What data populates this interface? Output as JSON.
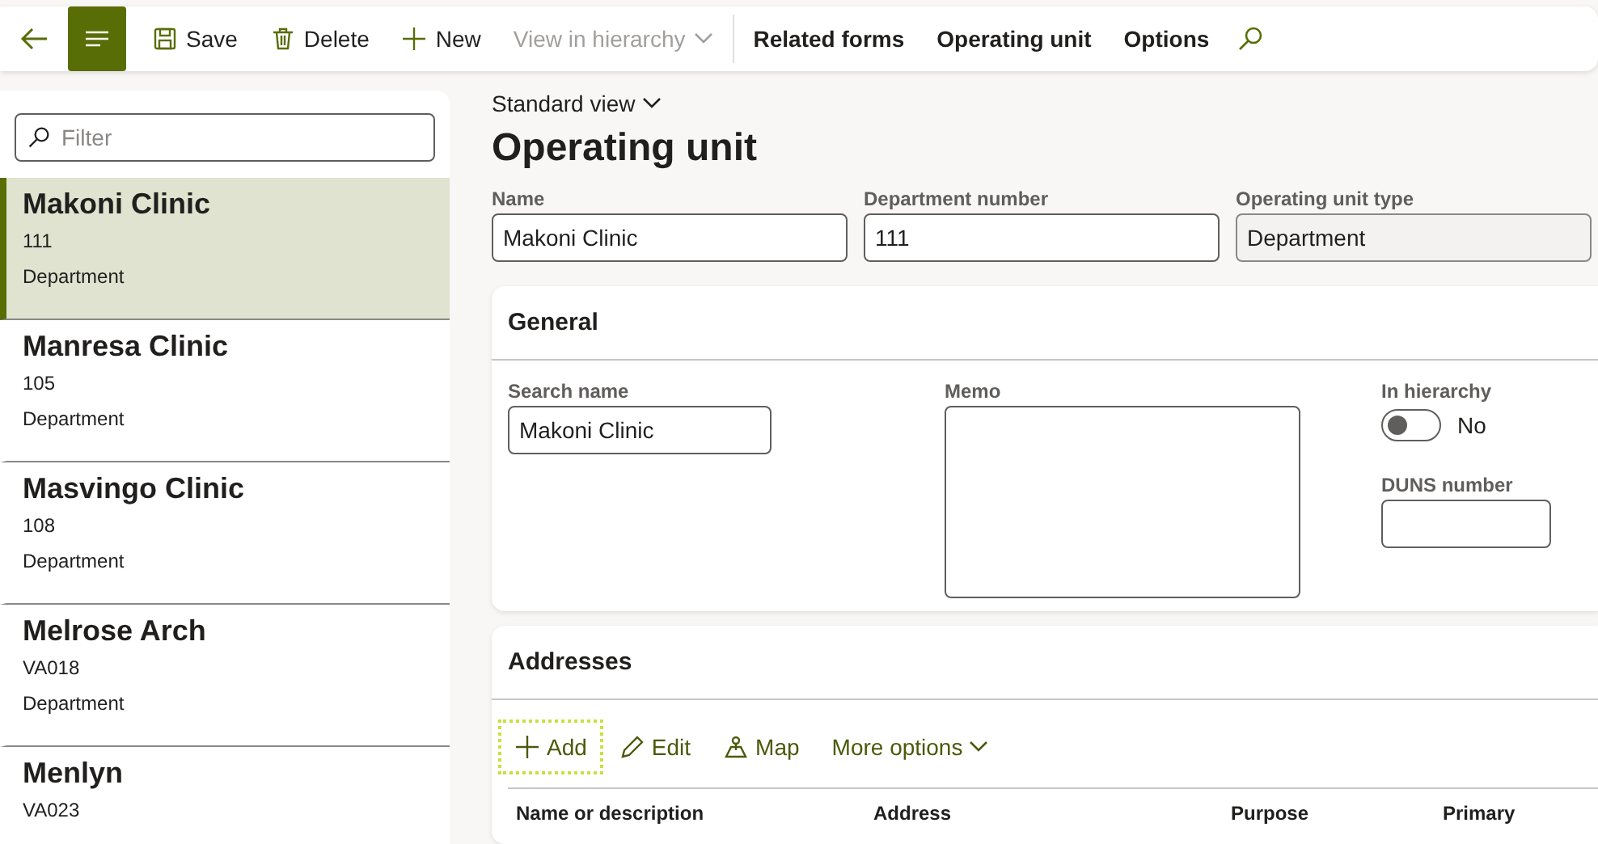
{
  "toolbar": {
    "items": [
      {
        "kind": "action",
        "label": "Save",
        "disabled": false
      },
      {
        "kind": "action",
        "label": "Delete",
        "disabled": false
      },
      {
        "kind": "action",
        "label": "New",
        "disabled": false
      },
      {
        "kind": "dropdown",
        "label": "View in hierarchy",
        "disabled": true
      },
      {
        "kind": "divider"
      },
      {
        "kind": "tab",
        "label": "Related forms"
      },
      {
        "kind": "tab",
        "label": "Operating unit"
      },
      {
        "kind": "tab",
        "label": "Options"
      }
    ],
    "menu_selected": true
  },
  "sidebar": {
    "filter": {
      "placeholder": "Filter"
    },
    "items": [
      {
        "name": "Makoni Clinic",
        "number": "111",
        "type": "Department",
        "selected": true
      },
      {
        "name": "Manresa Clinic",
        "number": "105",
        "type": "Department",
        "selected": false
      },
      {
        "name": "Masvingo Clinic",
        "number": "108",
        "type": "Department",
        "selected": false
      },
      {
        "name": "Melrose Arch",
        "number": "VA018",
        "type": "Department",
        "selected": false
      },
      {
        "name": "Menlyn",
        "number": "VA023",
        "selected": false
      }
    ]
  },
  "view": "Standard view",
  "title": "Operating unit",
  "header_fields": [
    {
      "label": "Name",
      "value": "Makoni Clinic",
      "disabled": false
    },
    {
      "label": "Department number",
      "value": "111",
      "disabled": false
    },
    {
      "label": "Operating unit type",
      "value": "Department",
      "disabled": true
    }
  ],
  "general": {
    "title": "General",
    "search_name": {
      "label": "Search name",
      "value": "Makoni Clinic"
    },
    "memo": {
      "label": "Memo"
    },
    "in_hierarchy": {
      "label": "In hierarchy",
      "on": false,
      "text": "No"
    },
    "duns": {
      "label": "DUNS number"
    }
  },
  "addresses": {
    "title": "Addresses",
    "actions": [
      {
        "kind": "action",
        "label": "Add",
        "focused": true
      },
      {
        "kind": "action",
        "label": "Edit",
        "focused": false
      },
      {
        "kind": "action",
        "label": "Map",
        "focused": false
      },
      {
        "kind": "dropdown",
        "label": "More options",
        "focused": false
      }
    ],
    "columns": [
      "Name or description",
      "Address",
      "Purpose",
      "Primary"
    ]
  }
}
